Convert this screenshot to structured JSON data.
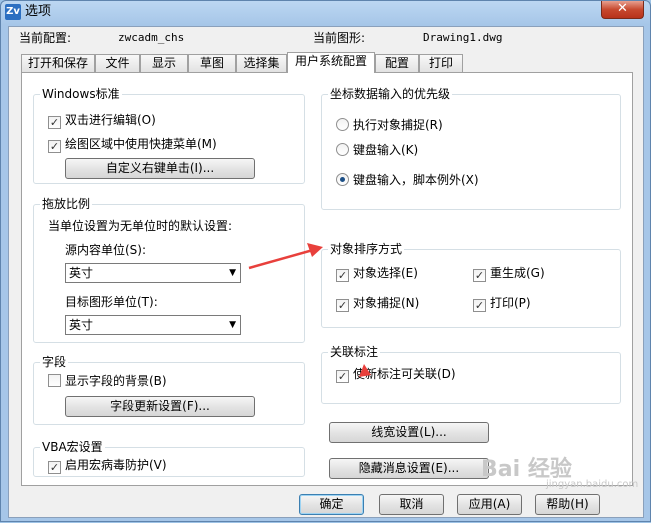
{
  "window": {
    "title": "选项"
  },
  "header": {
    "current_config_label": "当前配置:",
    "current_config_value": "zwcadm_chs",
    "current_drawing_label": "当前图形:",
    "current_drawing_value": "Drawing1.dwg"
  },
  "tabs": [
    {
      "label": "打开和保存",
      "active": false
    },
    {
      "label": "文件",
      "active": false
    },
    {
      "label": "显示",
      "active": false
    },
    {
      "label": "草图",
      "active": false
    },
    {
      "label": "选择集",
      "active": false
    },
    {
      "label": "用户系统配置",
      "active": true
    },
    {
      "label": "配置",
      "active": false
    },
    {
      "label": "打印",
      "active": false
    }
  ],
  "windows_std": {
    "title": "Windows标准",
    "dblclick_label": "双击进行编辑(O)",
    "shortcut_menu_label": "绘图区域中使用快捷菜单(M)",
    "customize_button": "自定义右键单击(I)..."
  },
  "insert_scale": {
    "title": "拖放比例",
    "subtitle": "当单位设置为无单位时的默认设置:",
    "source_label": "源内容单位(S):",
    "source_value": "英寸",
    "target_label": "目标图形单位(T):",
    "target_value": "英寸"
  },
  "fields": {
    "title": "字段",
    "bg_label": "显示字段的背景(B)",
    "update_button": "字段更新设置(F)..."
  },
  "vba": {
    "title": "VBA宏设置",
    "virus_label": "启用宏病毒防护(V)"
  },
  "coord_input": {
    "title": "坐标数据输入的优先级",
    "opt1": "执行对象捕捉(R)",
    "opt2": "键盘输入(K)",
    "opt3": "键盘输入，脚本例外(X)"
  },
  "sort_method": {
    "title": "对象排序方式",
    "obj_select": "对象选择(E)",
    "regen": "重生成(G)",
    "obj_snap": "对象捕捉(N)",
    "plot": "打印(P)"
  },
  "assoc_dim": {
    "title": "关联标注",
    "new_assoc": "使新标注可关联(D)"
  },
  "lineweight_button": "线宽设置(L)...",
  "hidden_msg_button": "隐藏消息设置(E)...",
  "footer": {
    "ok": "确定",
    "cancel": "取消",
    "apply": "应用(A)",
    "help": "帮助(H)"
  },
  "watermark": {
    "main": "Bai 经验",
    "sub": "jingyan.baidu.com"
  },
  "colors": {
    "annotation_arrow": "#e8403c"
  }
}
